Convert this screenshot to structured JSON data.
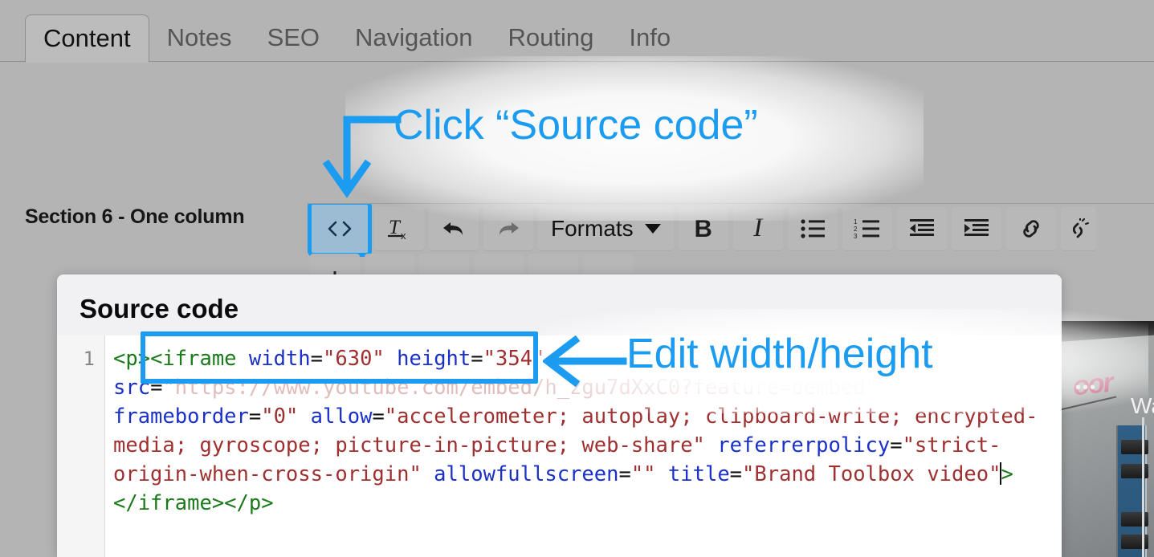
{
  "tabs": [
    {
      "label": "Content",
      "active": true
    },
    {
      "label": "Notes",
      "active": false
    },
    {
      "label": "SEO",
      "active": false
    },
    {
      "label": "Navigation",
      "active": false
    },
    {
      "label": "Routing",
      "active": false
    },
    {
      "label": "Info",
      "active": false
    }
  ],
  "section": {
    "label": "Section 6 - One column"
  },
  "toolbar": {
    "row1": [
      {
        "name": "source-code-button",
        "icon": "code-brackets-icon",
        "label": "<>",
        "highlighted": true
      },
      {
        "name": "clear-formatting-button",
        "icon": "clear-format-icon",
        "label": "",
        "highlighted": false
      },
      {
        "name": "undo-button",
        "icon": "undo-arrow-icon",
        "label": "",
        "highlighted": false
      },
      {
        "name": "redo-button",
        "icon": "redo-arrow-icon",
        "label": "",
        "highlighted": false
      },
      {
        "name": "formats-dropdown",
        "icon": "chevron-down-icon",
        "label": "Formats",
        "highlighted": false
      },
      {
        "name": "bold-button",
        "icon": "bold-icon",
        "label": "B",
        "highlighted": false
      },
      {
        "name": "italic-button",
        "icon": "italic-icon",
        "label": "I",
        "highlighted": false
      },
      {
        "name": "bullet-list-button",
        "icon": "bullet-list-icon",
        "label": "",
        "highlighted": false
      },
      {
        "name": "numbered-list-button",
        "icon": "numbered-list-icon",
        "label": "",
        "highlighted": false
      },
      {
        "name": "outdent-button",
        "icon": "outdent-icon",
        "label": "",
        "highlighted": false
      },
      {
        "name": "indent-button",
        "icon": "indent-icon",
        "label": "",
        "highlighted": false
      },
      {
        "name": "link-button",
        "icon": "link-chain-icon",
        "label": "",
        "highlighted": false
      },
      {
        "name": "unlink-button",
        "icon": "unlink-icon",
        "label": "",
        "highlighted": false
      }
    ],
    "formats_label": "Formats",
    "bold_label": "B",
    "italic_label": "I",
    "source_code_label": "<>"
  },
  "annotations": [
    {
      "name": "click-source-code-annotation",
      "text": "Click “Source code”",
      "color": "#1b9cf0"
    },
    {
      "name": "edit-width-height-annotation",
      "text": "Edit width/height",
      "color": "#1b9cf0"
    }
  ],
  "dialog": {
    "title": "Source code",
    "line_number": "1",
    "code": {
      "p_open": "<p>",
      "iframe_open": "<iframe ",
      "attr_width": "width",
      "val_width": "\"630\"",
      "attr_height": "height",
      "val_height": "\"354\"",
      "attr_src": "src",
      "val_src": "\"https://www.youtube.com/embed/h_zgu7dXxC0?feature=oembed\"",
      "attr_frameborder": "frameborder",
      "val_frameborder": "\"0\"",
      "attr_allow": "allow",
      "val_allow": "\"accelerometer; autoplay; clipboard-write; encrypted-media; gyroscope; picture-in-picture; web-share\"",
      "attr_referrerpolicy": "referrerpolicy",
      "val_referrerpolicy": "\"strict-origin-when-cross-origin\"",
      "attr_allowfullscreen": "allowfullscreen",
      "val_allowfullscreen": "\"\"",
      "attr_title": "title",
      "val_title": "\"Brand Toolbox video\"",
      "gt": ">",
      "iframe_close": "</iframe>",
      "p_close": "</p>"
    },
    "highlight_color": "#1b9cf0"
  },
  "video_thumb": {
    "overlay_text": "Wat",
    "menu_dots": "•••"
  },
  "colors": {
    "accent": "#1b9cf0",
    "chrome_bg": "#b4b4b4",
    "dialog_bg": "#f1f1f4",
    "code_active_line_bg": "#eaf0fb",
    "tag": "#1a7a1a",
    "attr": "#1a30c8",
    "string": "#a03030",
    "highlight_button_bg": "#9cbcd4"
  }
}
